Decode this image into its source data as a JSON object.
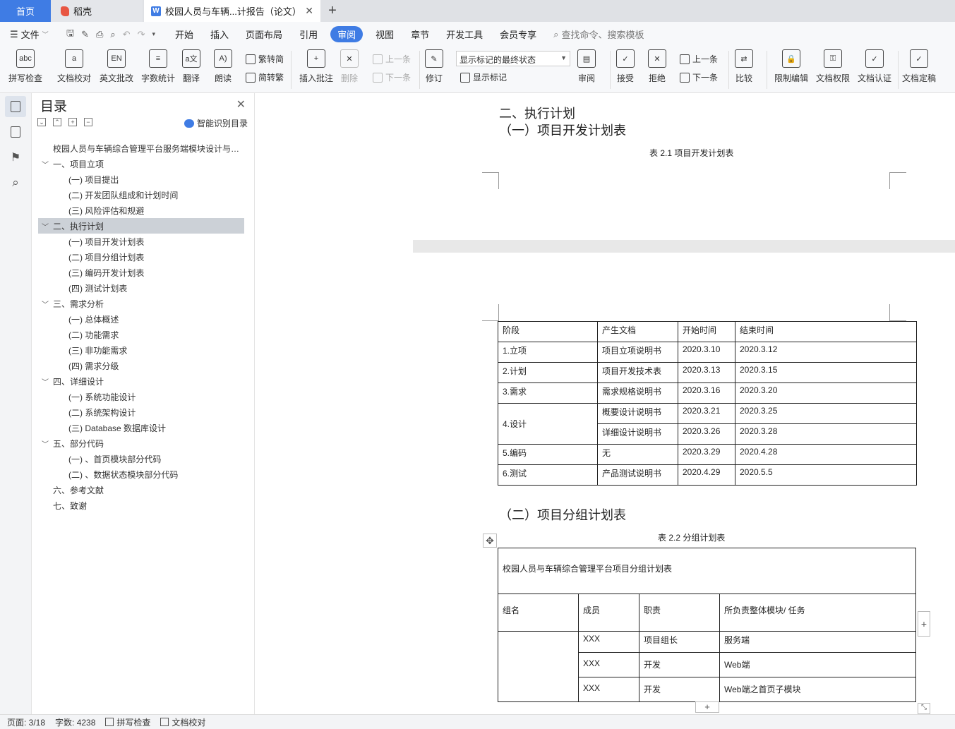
{
  "tabs": {
    "home": "首页",
    "daoke": "稻壳",
    "document": "校园人员与车辆...计报告（论文）"
  },
  "menu": {
    "file": "文件",
    "items": [
      "开始",
      "插入",
      "页面布局",
      "引用",
      "审阅",
      "视图",
      "章节",
      "开发工具",
      "会员专享"
    ],
    "active": "审阅",
    "search": "查找命令、搜索模板"
  },
  "ribbon": {
    "spell_check": "拼写检查",
    "doc_proof": "文档校对",
    "en_review": "英文批改",
    "word_count": "字数统计",
    "translate": "翻译",
    "read_aloud": "朗读",
    "trad_to_simp": "繁转简",
    "simp_to_trad": "简转繁",
    "insert_comment": "插入批注",
    "delete": "删除",
    "prev_comment": "上一条",
    "next_comment": "下一条",
    "revise": "修订",
    "mark_state": "显示标记的最终状态",
    "show_marks": "显示标记",
    "review": "审阅",
    "accept": "接受",
    "reject": "拒绝",
    "prev": "上一条",
    "next": "下一条",
    "compare": "比较",
    "restrict_edit": "限制编辑",
    "doc_rights": "文档权限",
    "doc_auth": "文档认证",
    "doc_final": "文档定稿"
  },
  "toc": {
    "title": "目录",
    "smart": "智能识别目录",
    "items": [
      {
        "label": "校园人员与车辆综合管理平台服务端模块设计与实现",
        "level": 0
      },
      {
        "label": "一、项目立项",
        "level": 1
      },
      {
        "label": "(一) 项目提出",
        "level": 2
      },
      {
        "label": "(二) 开发团队组成和计划时间",
        "level": 2
      },
      {
        "label": "(三) 风险评估和规避",
        "level": 2
      },
      {
        "label": "二、执行计划",
        "level": 1,
        "active": true
      },
      {
        "label": "(一) 项目开发计划表",
        "level": 2
      },
      {
        "label": "(二) 项目分组计划表",
        "level": 2
      },
      {
        "label": "(三) 编码开发计划表",
        "level": 2
      },
      {
        "label": "(四) 测试计划表",
        "level": 2
      },
      {
        "label": "三、需求分析",
        "level": 1
      },
      {
        "label": "(一) 总体概述",
        "level": 2
      },
      {
        "label": "(二) 功能需求",
        "level": 2
      },
      {
        "label": "(三) 非功能需求",
        "level": 2
      },
      {
        "label": "(四) 需求分级",
        "level": 2
      },
      {
        "label": "四、详细设计",
        "level": 1
      },
      {
        "label": "(一) 系统功能设计",
        "level": 2
      },
      {
        "label": "(二) 系统架构设计",
        "level": 2
      },
      {
        "label": "(三) Database 数据库设计",
        "level": 2
      },
      {
        "label": "五、部分代码",
        "level": 1
      },
      {
        "label": "(一) 、首页模块部分代码",
        "level": 2
      },
      {
        "label": "(二) 、数据状态模块部分代码",
        "level": 2
      },
      {
        "label": "六、参考文献",
        "level": 1,
        "nocaret": true
      },
      {
        "label": "七、致谢",
        "level": 1,
        "nocaret": true
      }
    ]
  },
  "doc": {
    "heading_plan": "二、执行计划",
    "heading_dev": "（一）项目开发计划表",
    "caption1": "表 2.1 项目开发计划表",
    "table1": {
      "headers": [
        "阶段",
        "产生文档",
        "开始时间",
        "结束时间"
      ],
      "rows": [
        [
          "1.立项",
          "项目立项说明书",
          "2020.3.10",
          "2020.3.12"
        ],
        [
          "2.计划",
          "项目开发技术表",
          "2020.3.13",
          "2020.3.15"
        ],
        [
          "3.需求",
          "需求规格说明书",
          "2020.3.16",
          "2020.3.20"
        ],
        [
          "4.设计",
          "概要设计说明书",
          "2020.3.21",
          "2020.3.25"
        ],
        [
          "",
          "详细设计说明书",
          "2020.3.26",
          "2020.3.28"
        ],
        [
          "5.编码",
          "无",
          "2020.3.29",
          "2020.4.28"
        ],
        [
          "6.测试",
          "产品测试说明书",
          "2020.4.29",
          "2020.5.5"
        ]
      ]
    },
    "heading_group": "（二）项目分组计划表",
    "caption2": "表 2.2 分组计划表",
    "table2": {
      "title": "校园人员与车辆综合管理平台项目分组计划表",
      "headers": [
        "组名",
        "成员",
        "职责",
        "所负责整体模块/ 任务"
      ],
      "rows": [
        [
          "XXX",
          "项目组长",
          "服务端"
        ],
        [
          "XXX",
          "开发",
          "Web端"
        ],
        [
          "XXX",
          "开发",
          "Web端之首页子模块"
        ]
      ]
    }
  },
  "status": {
    "page": "页面: 3/18",
    "words": "字数: 4238",
    "spell": "拼写检查",
    "proof": "文档校对"
  },
  "colors": {
    "accent": "#3f7ce4",
    "toc_active": "#ccd1d7"
  }
}
